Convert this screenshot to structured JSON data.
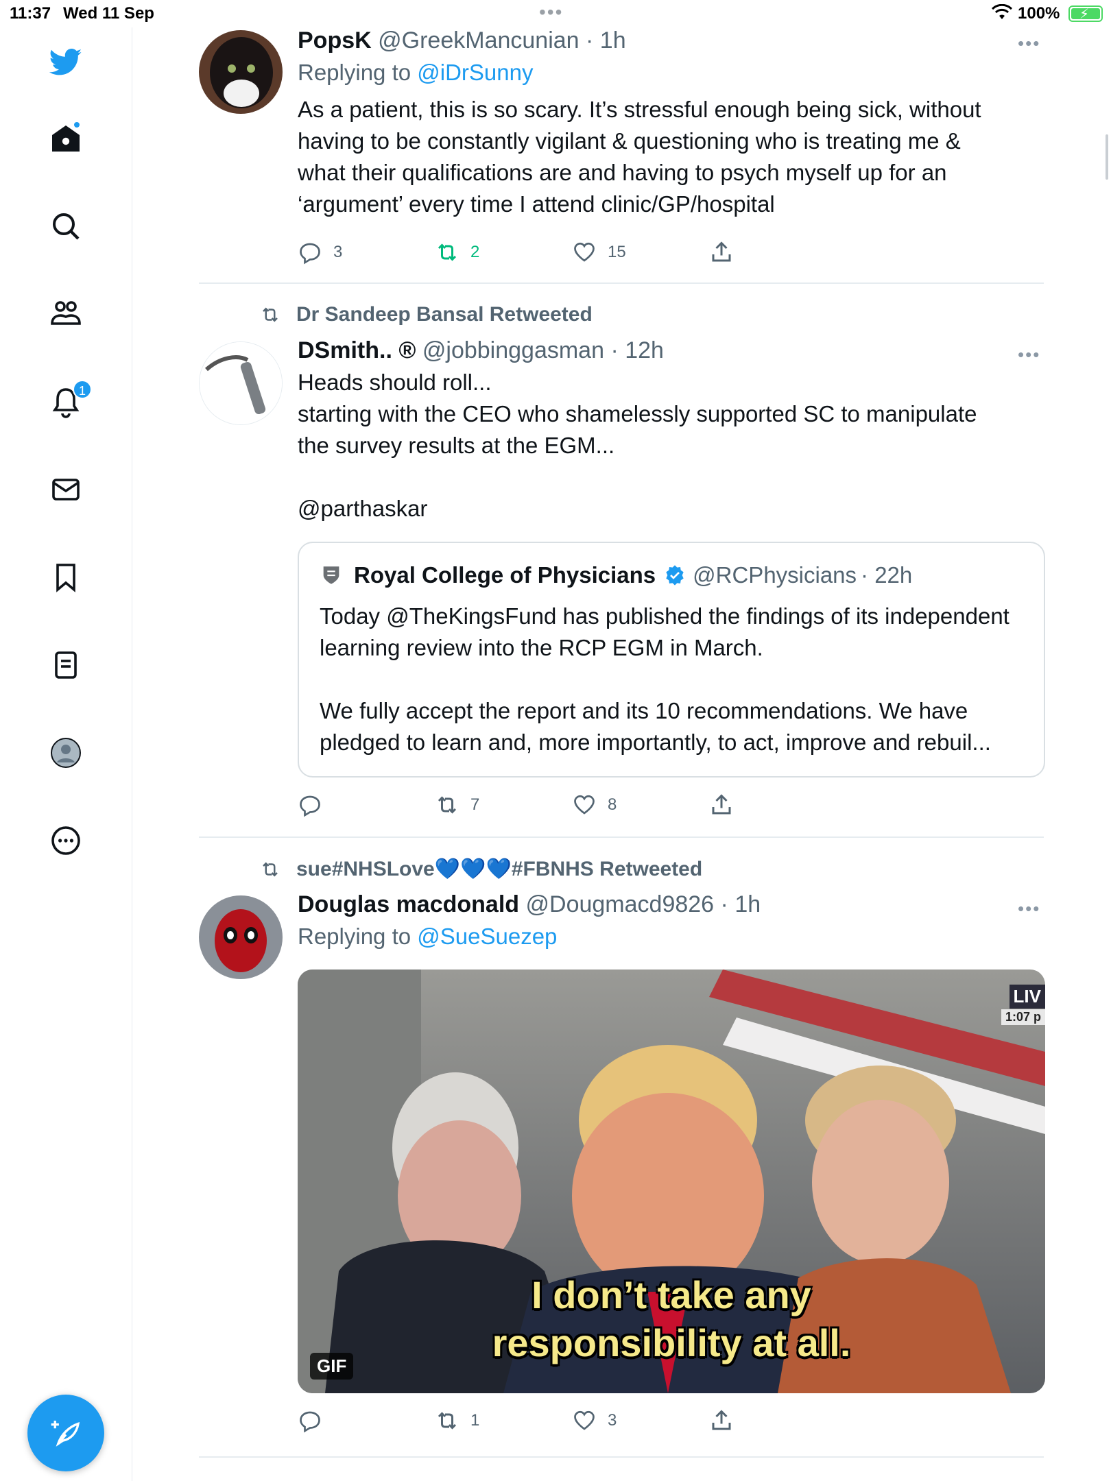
{
  "status_bar": {
    "time": "11:37",
    "date": "Wed 11 Sep",
    "battery": "100%"
  },
  "sidebar": {
    "items": [
      {
        "name": "twitter-logo"
      },
      {
        "name": "home"
      },
      {
        "name": "search"
      },
      {
        "name": "communities"
      },
      {
        "name": "notifications",
        "badge": "1"
      },
      {
        "name": "messages"
      },
      {
        "name": "bookmarks"
      },
      {
        "name": "lists"
      },
      {
        "name": "profile"
      },
      {
        "name": "more"
      }
    ],
    "accent": "#1d9bf0"
  },
  "tweets": [
    {
      "name": "PopsK",
      "handle": "@GreekMancunian",
      "time": "· 1h",
      "replying_label": "Replying to ",
      "replying_to": "@iDrSunny",
      "body": "As a patient, this is so scary. It’s stressful enough being sick, without having to be constantly vigilant & questioning who is treating me & what their qualifications are and having to psych myself up for an ‘argument’ every time I attend clinic/GP/hospital",
      "replies": "3",
      "retweets": "2",
      "likes": "15"
    },
    {
      "retweeted_by": "Dr Sandeep Bansal Retweeted",
      "name": "DSmith..",
      "reg": "®",
      "handle": "@jobbinggasman",
      "time": "· 12h",
      "body_line1": "Heads should roll...",
      "body_line2": "starting with the CEO who shamelessly supported SC to manipulate the survey results at the EGM...",
      "mention": "@parthaskar",
      "quote": {
        "name": "Royal College of Physicians",
        "handle": "@RCPhysicians",
        "time": "· 22h",
        "body_p1": "Today @TheKingsFund has published the findings of its independent learning review into the RCP EGM in March.",
        "body_p2": "We fully accept the report and its 10 recommendations. We have pledged to learn and, more importantly, to act, improve and rebuil..."
      },
      "replies": "",
      "retweets": "7",
      "likes": "8"
    },
    {
      "retweeted_by": "sue#NHSLove💙💙💙#FBNHS Retweeted",
      "name": "Douglas macdonald",
      "handle": "@Dougmacd9826",
      "time": "· 1h",
      "replying_label": "Replying to ",
      "replying_to": "@SueSuezep",
      "media": {
        "caption_line1": "I don’t take any",
        "caption_line2": "responsibility at all.",
        "gif_label": "GIF",
        "live_tag": "LIV",
        "live_time": "1:07 p"
      },
      "replies": "",
      "retweets": "1",
      "likes": "3"
    }
  ]
}
